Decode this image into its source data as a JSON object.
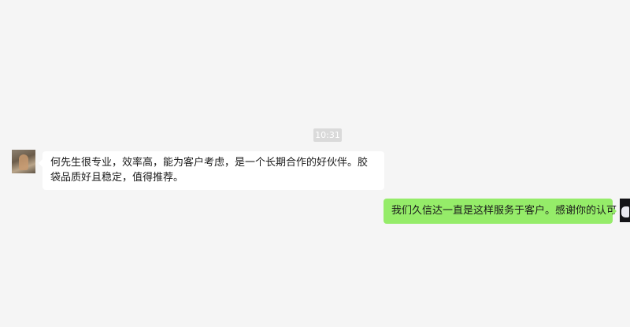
{
  "chat": {
    "timestamp": "10:31",
    "messages": [
      {
        "direction": "incoming",
        "text": "何先生很专业，效率高，能为客户考虑，是一个长期合作的好伙伴。胶袋品质好且稳定，值得推荐。",
        "bubble_color": "#ffffff"
      },
      {
        "direction": "outgoing",
        "text": "我们久信达一直是这样服务于客户。感谢你的认可",
        "bubble_color": "#95ec69"
      }
    ]
  },
  "colors": {
    "background": "#f5f5f5",
    "timestamp_bg": "#dadada",
    "outgoing_bubble": "#95ec69",
    "incoming_bubble": "#ffffff"
  }
}
